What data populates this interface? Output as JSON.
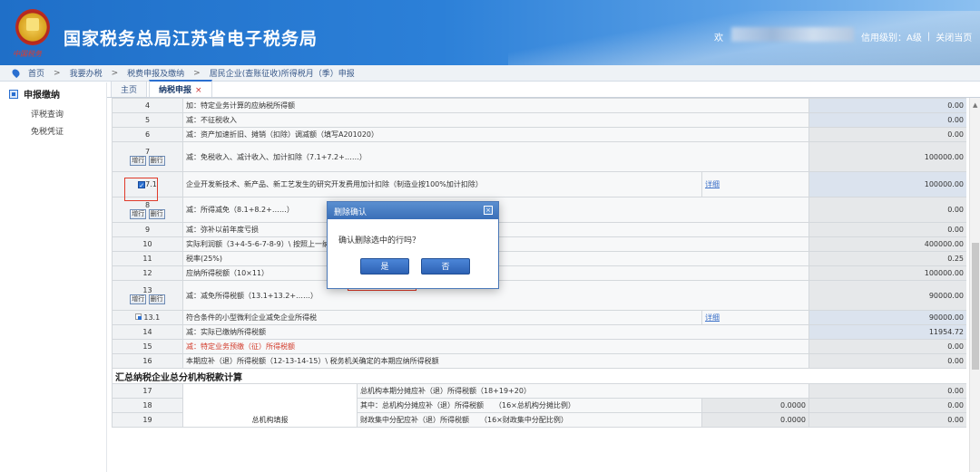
{
  "header": {
    "slogan": "中国税务",
    "title": "国家税务总局江苏省电子税务局",
    "welcome": "欢",
    "credit": "信用级别：A级",
    "sep": "|",
    "close_page": "关闭当页"
  },
  "breadcrumb": {
    "items": [
      "首页",
      "我要办税",
      "税费申报及缴纳",
      "居民企业(查账征收)所得税月（季）申报"
    ],
    "sep": ">"
  },
  "sidebar": {
    "heading": "申报缴纳",
    "items": [
      "评税查询",
      "免税凭证"
    ]
  },
  "tabs": [
    {
      "label": "主页",
      "closable": false
    },
    {
      "label": "纳税申报",
      "closable": true,
      "close": "×"
    }
  ],
  "buttons": {
    "add_row": "增行",
    "delete_row": "删行",
    "details": "详细"
  },
  "rows": [
    {
      "num": "4",
      "label": "加：特定业务计算的应纳税所得额",
      "value": "0.00"
    },
    {
      "num": "5",
      "label": "减：不征税收入",
      "value": "0.00"
    },
    {
      "num": "6",
      "label": "减：资产加速折旧、摊销（扣除）调减额（填写A201020）",
      "value": "0.00"
    },
    {
      "num": "7",
      "label": "减：免税收入、减计收入、加计扣除（7.1+7.2+……）",
      "value": "100000.00"
    },
    {
      "num": "7.1",
      "label": "企业开发新技术、新产品、新工艺发生的研究开发费用加计扣除（制造业按100%加计扣除）",
      "value": "100000.00"
    },
    {
      "num": "8",
      "label": "减：所得减免（8.1+8.2+……）",
      "value": "0.00"
    },
    {
      "num": "9",
      "label": "减：弥补以前年度亏损",
      "value": "0.00"
    },
    {
      "num": "10",
      "label": "实际利润额（3+4-5-6-7-8-9）\\ 按照上一纳",
      "value": "400000.00"
    },
    {
      "num": "11",
      "label": "税率(25%)",
      "value": "0.25"
    },
    {
      "num": "12",
      "label": "应纳所得税额（10×11）",
      "value": "100000.00"
    },
    {
      "num": "13",
      "label": "减：减免所得税额（13.1+13.2+……）",
      "value": "90000.00"
    },
    {
      "num": "13.1",
      "label": "符合条件的小型微利企业减免企业所得税",
      "value": "90000.00"
    },
    {
      "num": "14",
      "label": "减：实际已缴纳所得税额",
      "value": "11954.72"
    },
    {
      "num": "15",
      "label": "减：特定业务预缴（征）所得税额",
      "value": "0.00"
    },
    {
      "num": "16",
      "label": "本期应补（退）所得税额（12-13-14-15）\\ 税务机关确定的本期应纳所得税额",
      "value": "0.00"
    }
  ],
  "section": {
    "title": "汇总纳税企业总分机构税款计算"
  },
  "branch_rows": [
    {
      "num": "17",
      "label": "总机构本期分摊应补（退）所得税额（18+19+20）",
      "ratio": "",
      "value": "0.00"
    },
    {
      "num": "18",
      "label": "其中：总机构分摊应补（退）所得税额　　（16×总机构分摊比例）",
      "ratio": "0.0000",
      "value": "0.00"
    },
    {
      "num": "19",
      "label": "财政集中分配应补（退）所得税额　　（16×财政集中分配比例）",
      "ratio": "0.0000",
      "value": "0.00"
    }
  ],
  "branch_group": "总机构填报",
  "dialog": {
    "title": "删除确认",
    "close": "×",
    "message": "确认删除选中的行吗？",
    "yes": "是",
    "no": "否"
  },
  "scrollbar": {
    "up": "▲"
  }
}
